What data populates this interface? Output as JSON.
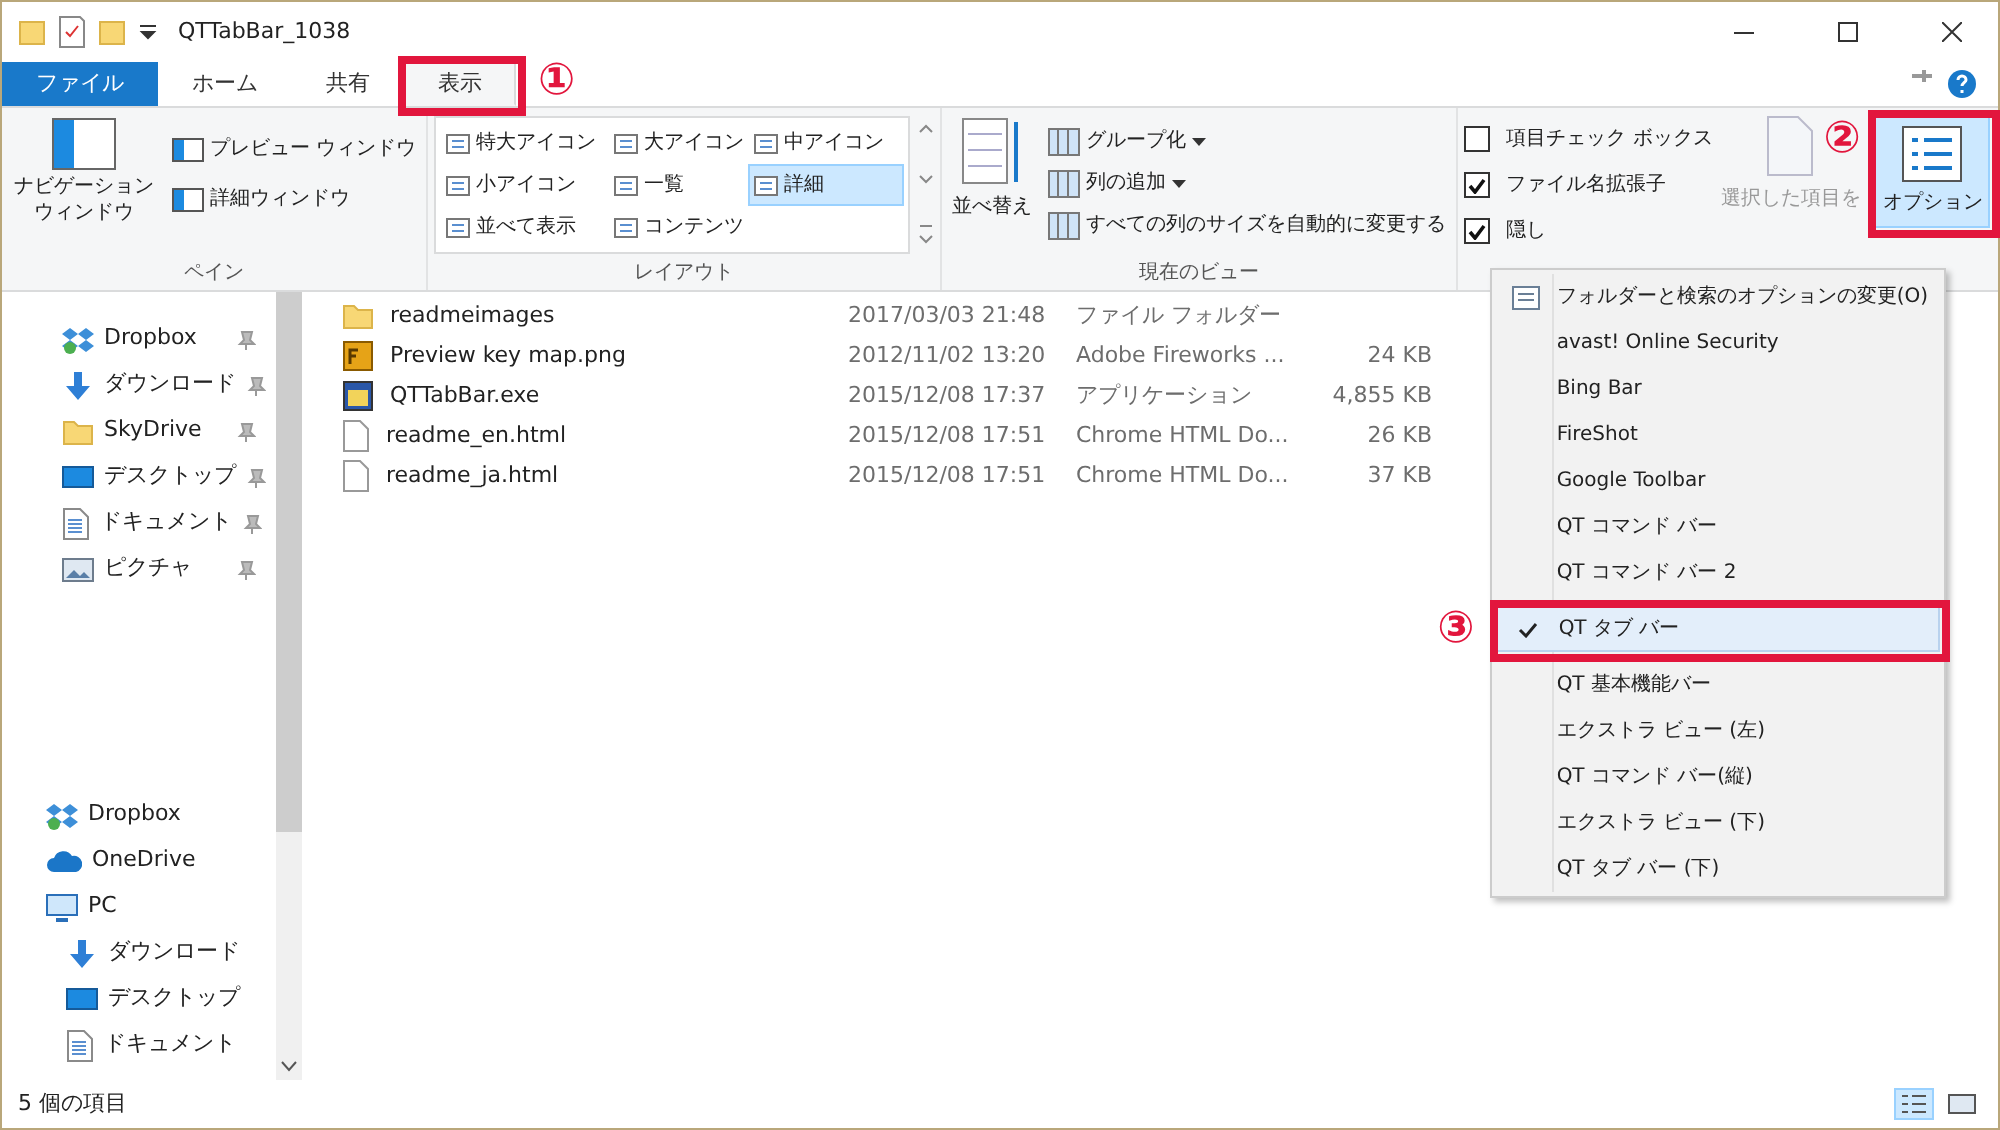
{
  "window": {
    "title": "QTTabBar_1038"
  },
  "ribbon_tabs": [
    {
      "label": "ファイル",
      "kind": "file",
      "selected": false
    },
    {
      "label": "ホーム",
      "kind": "tab",
      "selected": false
    },
    {
      "label": "共有",
      "kind": "tab",
      "selected": false
    },
    {
      "label": "表示",
      "kind": "tab",
      "selected": true,
      "annotation": "①"
    }
  ],
  "ribbon": {
    "pane": {
      "label": "ペイン",
      "nav_button": "ナビゲーションウィンドウ",
      "items": [
        "プレビュー ウィンドウ",
        "詳細ウィンドウ"
      ]
    },
    "layout": {
      "label": "レイアウト",
      "options": [
        {
          "label": "特大アイコン",
          "selected": false
        },
        {
          "label": "大アイコン",
          "selected": false
        },
        {
          "label": "中アイコン",
          "selected": false
        },
        {
          "label": "小アイコン",
          "selected": false
        },
        {
          "label": "一覧",
          "selected": false
        },
        {
          "label": "詳細",
          "selected": true
        },
        {
          "label": "並べて表示",
          "selected": false
        },
        {
          "label": "コンテンツ",
          "selected": false
        }
      ]
    },
    "current_view": {
      "label": "現在のビュー",
      "sort_button": "並べ替え",
      "items": [
        {
          "label": "グループ化",
          "dropdown": true
        },
        {
          "label": "列の追加",
          "dropdown": true
        },
        {
          "label": "すべての列のサイズを自動的に変更する",
          "dropdown": false
        }
      ]
    },
    "show_hide": {
      "checkboxes": [
        {
          "label": "項目チェック ボックス",
          "checked": false
        },
        {
          "label": "ファイル名拡張子",
          "checked": true
        },
        {
          "label": "隠し",
          "checked": true
        }
      ],
      "hide_selected": "選択した項目を"
    },
    "options_button": {
      "label": "オプション",
      "annotation": "②"
    }
  },
  "nav": [
    {
      "label": "Dropbox",
      "kind": "dropbox",
      "pinned": true
    },
    {
      "label": "ダウンロード",
      "kind": "download",
      "pinned": true
    },
    {
      "label": "SkyDrive",
      "kind": "folder",
      "pinned": true
    },
    {
      "label": "デスクトップ",
      "kind": "desktop",
      "pinned": true
    },
    {
      "label": "ドキュメント",
      "kind": "document",
      "pinned": true
    },
    {
      "label": "ピクチャ",
      "kind": "picture",
      "pinned": true
    }
  ],
  "nav_lower": [
    {
      "label": "Dropbox",
      "kind": "dropbox"
    },
    {
      "label": "OneDrive",
      "kind": "onedrive"
    },
    {
      "label": "PC",
      "kind": "pc",
      "children": [
        {
          "label": "ダウンロード",
          "kind": "download"
        },
        {
          "label": "デスクトップ",
          "kind": "desktop"
        },
        {
          "label": "ドキュメント",
          "kind": "document"
        }
      ]
    }
  ],
  "files": [
    {
      "name": "readmeimages",
      "kind": "folder",
      "date": "2017/03/03 21:48",
      "type": "ファイル フォルダー"
    },
    {
      "name": "Preview key map.png",
      "kind": "image",
      "date": "2012/11/02 13:20",
      "type": "Adobe Fireworks ...",
      "size": "24 KB"
    },
    {
      "name": "QTTabBar.exe",
      "kind": "app",
      "date": "2015/12/08 17:37",
      "type": "アプリケーション",
      "size": "4,855 KB"
    },
    {
      "name": "readme_en.html",
      "kind": "file",
      "date": "2015/12/08 17:51",
      "type": "Chrome HTML Do...",
      "size": "26 KB"
    },
    {
      "name": "readme_ja.html",
      "kind": "file",
      "date": "2015/12/08 17:51",
      "type": "Chrome HTML Do...",
      "size": "37 KB"
    }
  ],
  "menu": [
    {
      "label": "フォルダーと検索のオプションの変更(O)",
      "kind": "command",
      "checked": false,
      "selected": false
    },
    {
      "label": "avast! Online Security",
      "kind": "toolbar",
      "checked": false,
      "selected": false
    },
    {
      "label": "Bing Bar",
      "kind": "toolbar",
      "checked": false,
      "selected": false
    },
    {
      "label": "FireShot",
      "kind": "toolbar",
      "checked": false,
      "selected": false
    },
    {
      "label": "Google Toolbar",
      "kind": "toolbar",
      "checked": false,
      "selected": false
    },
    {
      "label": "QT コマンド バー",
      "kind": "toolbar",
      "checked": false,
      "selected": false
    },
    {
      "label": "QT コマンド バー 2",
      "kind": "toolbar",
      "checked": false,
      "selected": false
    },
    {
      "label": "QT タブ バー",
      "kind": "toolbar",
      "checked": true,
      "selected": true,
      "annotation": "③"
    },
    {
      "label": "QT 基本機能バー",
      "kind": "toolbar",
      "checked": false,
      "selected": false
    },
    {
      "label": "エクストラ ビュー (左)",
      "kind": "toolbar",
      "checked": false,
      "selected": false
    },
    {
      "label": "QT コマンド バー(縦)",
      "kind": "toolbar",
      "checked": false,
      "selected": false
    },
    {
      "label": "エクストラ ビュー (下)",
      "kind": "toolbar",
      "checked": false,
      "selected": false
    },
    {
      "label": "QT タブ バー (下)",
      "kind": "toolbar",
      "checked": false,
      "selected": false
    }
  ],
  "status_bar": {
    "text": "5 個の項目",
    "views": [
      {
        "kind": "details",
        "selected": true
      },
      {
        "kind": "large",
        "selected": false
      }
    ]
  }
}
